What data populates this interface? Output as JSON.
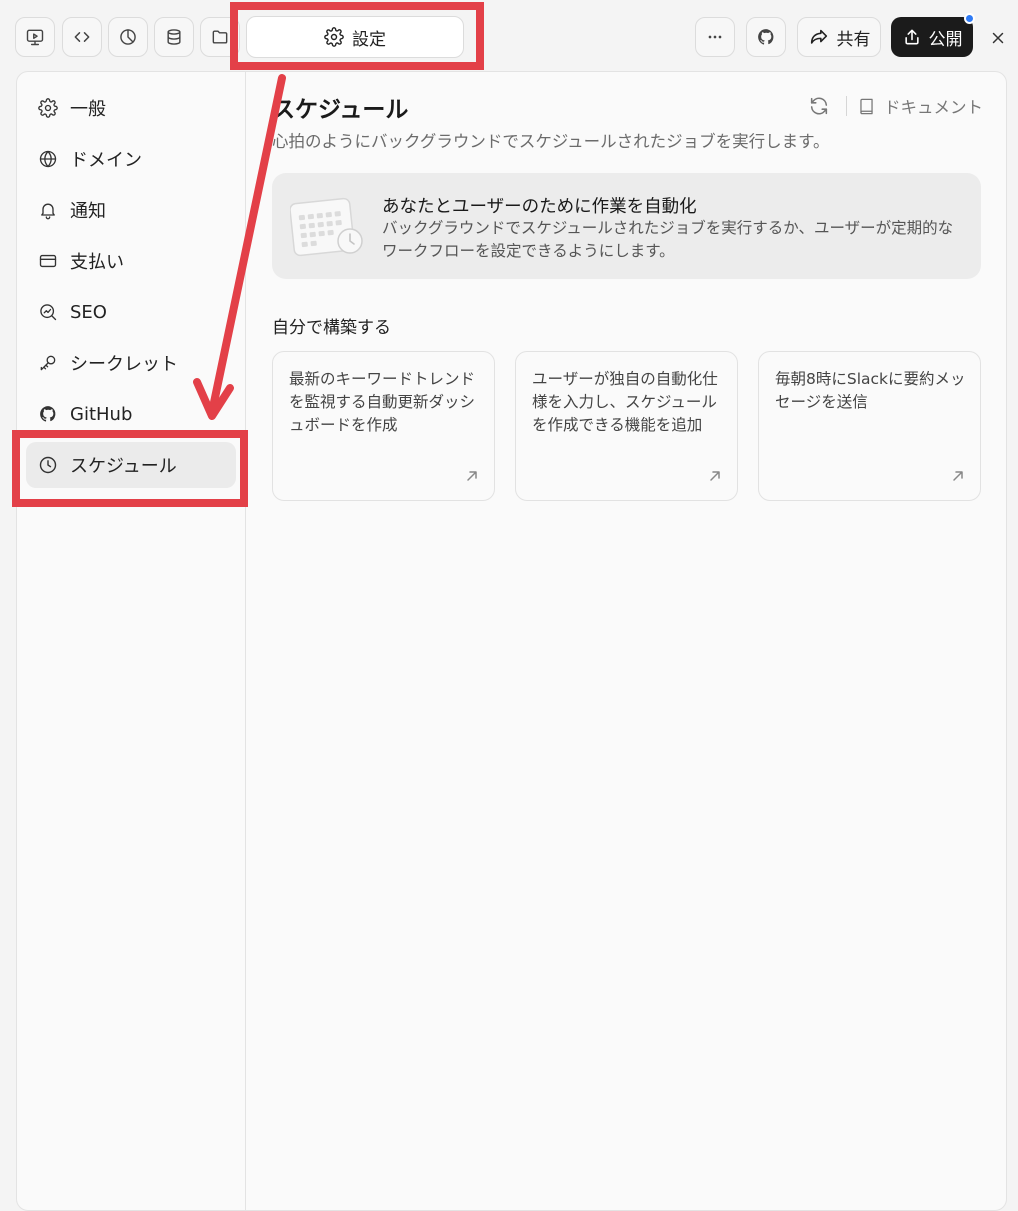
{
  "toolbar": {
    "buttons": [
      {
        "icon": "monitor-play-icon"
      },
      {
        "icon": "code-icon"
      },
      {
        "icon": "pie-chart-icon"
      },
      {
        "icon": "database-icon"
      },
      {
        "icon": "folder-icon"
      }
    ],
    "settings_tab_label": "設定",
    "more_icon": "more-horizontal-icon",
    "github_icon": "github-icon",
    "share_label": "共有",
    "publish_label": "公開",
    "publish_indicator_color": "#2f7bf5"
  },
  "sidebar": {
    "items": [
      {
        "label": "一般",
        "icon": "gear-icon"
      },
      {
        "label": "ドメイン",
        "icon": "globe-icon"
      },
      {
        "label": "通知",
        "icon": "bell-icon"
      },
      {
        "label": "支払い",
        "icon": "credit-card-icon"
      },
      {
        "label": "SEO",
        "icon": "seo-chart-icon"
      },
      {
        "label": "シークレット",
        "icon": "key-icon"
      },
      {
        "label": "GitHub",
        "icon": "github-icon"
      },
      {
        "label": "スケジュール",
        "icon": "clock-icon",
        "active": true
      }
    ]
  },
  "main": {
    "title": "スケジュール",
    "subtitle": "心拍のようにバックグラウンドでスケジュールされたジョブを実行します。",
    "docs_label": "ドキュメント",
    "banner": {
      "title": "あなたとユーザーのために作業を自動化",
      "text": "バックグラウンドでスケジュールされたジョブを実行するか、ユーザーが定期的なワークフローを設定できるようにします。"
    },
    "build_title": "自分で構築する",
    "cards": [
      {
        "text": "最新のキーワードトレンドを監視する自動更新ダッシュボードを作成"
      },
      {
        "text": "ユーザーが独自の自動化仕様を入力し、スケジュールを作成できる機能を追加"
      },
      {
        "text": "毎朝8時にSlackに要約メッセージを送信"
      }
    ]
  },
  "annotation_color": "#e34048"
}
